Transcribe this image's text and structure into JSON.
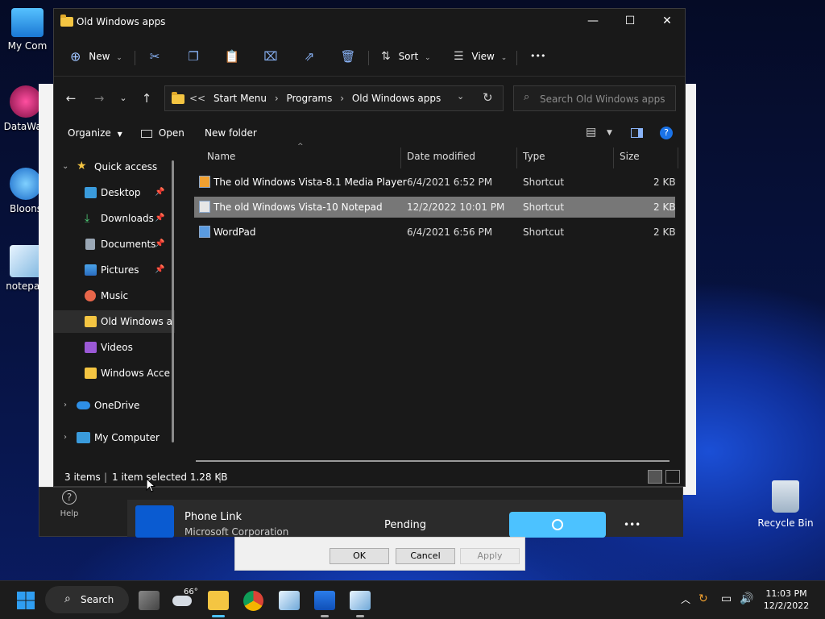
{
  "desktop": {
    "icons": [
      {
        "label": "My Com"
      },
      {
        "label": "DataWag"
      },
      {
        "label": "Bloons"
      },
      {
        "label": "notepad"
      }
    ],
    "recycle_bin": "Recycle Bin"
  },
  "window": {
    "title": "Old Windows apps",
    "controls": {
      "minimize": "—",
      "maximize": "☐",
      "close": "✕"
    }
  },
  "commandbar": {
    "new_label": "New",
    "sort_label": "Sort",
    "view_label": "View",
    "more_label": "•••"
  },
  "address": {
    "prefix": "<<",
    "crumbs": [
      "Start Menu",
      "Programs",
      "Old Windows apps"
    ],
    "separator": "›"
  },
  "search": {
    "placeholder": "Search Old Windows apps"
  },
  "secondary": {
    "organize": "Organize",
    "open": "Open",
    "new_folder": "New folder"
  },
  "navpane": {
    "quick_access": "Quick access",
    "items": [
      {
        "label": "Desktop",
        "pinned": true
      },
      {
        "label": "Downloads",
        "pinned": true
      },
      {
        "label": "Documents",
        "pinned": true
      },
      {
        "label": "Pictures",
        "pinned": true
      },
      {
        "label": "Music",
        "pinned": false
      },
      {
        "label": "Old Windows a",
        "pinned": false
      },
      {
        "label": "Videos",
        "pinned": false
      },
      {
        "label": "Windows Acce",
        "pinned": false
      }
    ],
    "onedrive": "OneDrive",
    "my_computer": "My Computer"
  },
  "columns": {
    "name": "Name",
    "date": "Date modified",
    "type": "Type",
    "size": "Size"
  },
  "files": [
    {
      "name": "The old Windows Vista-8.1 Media Player",
      "date": "6/4/2021 6:52 PM",
      "type": "Shortcut",
      "size": "2 KB",
      "selected": false
    },
    {
      "name": "The old Windows Vista-10 Notepad",
      "date": "12/2/2022 10:01 PM",
      "type": "Shortcut",
      "size": "2 KB",
      "selected": true
    },
    {
      "name": "WordPad",
      "date": "6/4/2021 6:56 PM",
      "type": "Shortcut",
      "size": "2 KB",
      "selected": false
    }
  ],
  "status": {
    "count": "3 items",
    "selection": "1 item selected  1.28 KB"
  },
  "background": {
    "help": "Help",
    "app_name": "Phone Link",
    "publisher": "Microsoft Corporation",
    "state": "Pending",
    "ok": "OK",
    "cancel": "Cancel",
    "apply": "Apply",
    "more": "•••"
  },
  "taskbar": {
    "search_label": "Search",
    "weather": "66°",
    "time": "11:03 PM",
    "date": "12/2/2022"
  }
}
